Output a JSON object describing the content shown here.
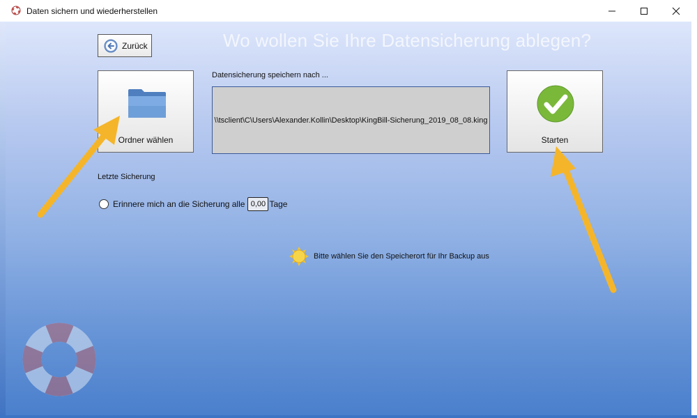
{
  "window": {
    "title": "Daten sichern und wiederherstellen",
    "minimize_icon": "minimize-icon",
    "maximize_icon": "maximize-icon",
    "close_icon": "close-icon"
  },
  "page": {
    "heading": "Wo wollen Sie Ihre Datensicherung ablegen?",
    "back_button": "Zurück",
    "choose_folder_button": "Ordner wählen",
    "save_to_label": "Datensicherung speichern nach ...",
    "save_path": "\\\\tsclient\\C\\Users\\Alexander.Kollin\\Desktop\\KingBill-Sicherung_2019_08_08.king",
    "start_button": "Starten",
    "last_backup_label": "Letzte Sicherung",
    "remind_label": "Erinnere mich an die Sicherung alle",
    "remind_days_value": "0,00",
    "remind_days_unit": "Tage",
    "hint_text": "Bitte wählen Sie den Speicherort für Ihr Backup aus"
  },
  "colors": {
    "accent_arrow": "#f5b52a",
    "check_green": "#7ab83a",
    "folder_blue": "#6f9fd8"
  }
}
